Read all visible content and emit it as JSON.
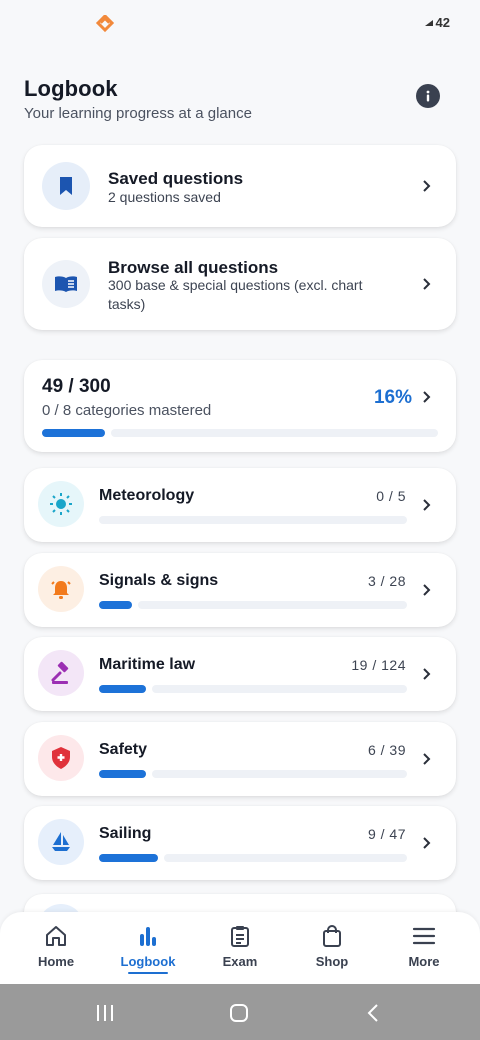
{
  "status_bar": {
    "battery": "42",
    "logo_color": "#f2893b"
  },
  "header": {
    "title": "Logbook",
    "subtitle": "Your learning progress at a glance",
    "info_icon": "info-icon"
  },
  "saved": {
    "title": "Saved questions",
    "subtitle": "2 questions saved",
    "icon": "bookmark-icon"
  },
  "browse": {
    "title": "Browse all questions",
    "subtitle": "300 base & special questions (excl. chart tasks)",
    "icon": "book-icon"
  },
  "summary": {
    "count": "49 / 300",
    "categories": "0 / 8 categories mastered",
    "percent": "16%",
    "progress": 0.16,
    "accent": "#1d6fd1"
  },
  "categories": [
    {
      "title": "Meteorology",
      "count": "0 / 5",
      "progress": 0.0,
      "icon": "sun-icon",
      "color": "#1aa5c9",
      "bg": "#e6f6fa"
    },
    {
      "title": "Signals & signs",
      "count": "3 / 28",
      "progress": 0.107,
      "icon": "bell-icon",
      "color": "#f27a1c",
      "bg": "#fdefe3"
    },
    {
      "title": "Maritime law",
      "count": "19 / 124",
      "progress": 0.153,
      "icon": "gavel-icon",
      "color": "#9b2fb3",
      "bg": "#f3e6f7"
    },
    {
      "title": "Safety",
      "count": "6 / 39",
      "progress": 0.154,
      "icon": "shield-icon",
      "color": "#e0323b",
      "bg": "#fde8ea"
    },
    {
      "title": "Sailing",
      "count": "9 / 47",
      "progress": 0.191,
      "icon": "sailboat-icon",
      "color": "#1d6fd1",
      "bg": "#e6effb"
    }
  ],
  "bottom_nav": [
    {
      "label": "Home",
      "icon": "home-icon",
      "active": false
    },
    {
      "label": "Logbook",
      "icon": "bar-chart-icon",
      "active": true
    },
    {
      "label": "Exam",
      "icon": "clipboard-icon",
      "active": false
    },
    {
      "label": "Shop",
      "icon": "shopping-bag-icon",
      "active": false
    },
    {
      "label": "More",
      "icon": "menu-icon",
      "active": false
    }
  ]
}
